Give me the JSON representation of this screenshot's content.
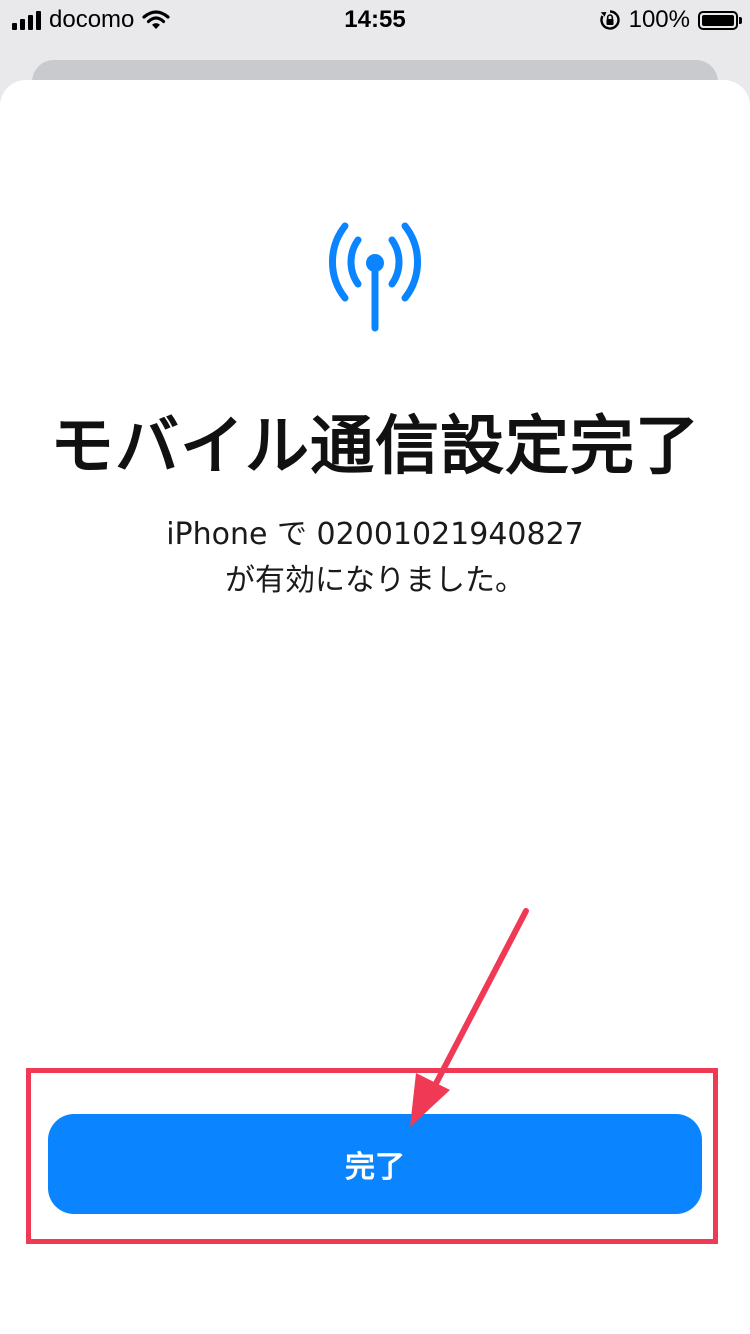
{
  "status_bar": {
    "carrier": "docomo",
    "time": "14:55",
    "battery": "100%"
  },
  "icons": {
    "signal": "cellular-signal-icon",
    "wifi": "wifi-icon",
    "orientation_lock": "orientation-lock-icon",
    "battery": "battery-icon",
    "antenna": "antenna-icon",
    "arrow": "annotation-arrow"
  },
  "main": {
    "title": "モバイル通信設定完了",
    "subtitle_line1": "iPhone で 02001021940827",
    "subtitle_line2": "が有効になりました。",
    "done_button": "完了"
  },
  "colors": {
    "accent": "#0a84ff",
    "annotation": "#f03a55"
  }
}
